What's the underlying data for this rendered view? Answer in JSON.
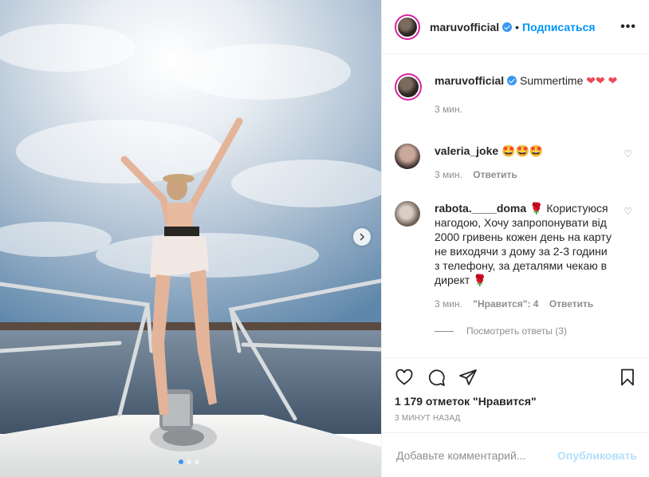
{
  "post": {
    "username": "maruvofficial",
    "separator": "•",
    "follow_label": "Подписаться",
    "more_label": "•••",
    "verified_color": "#3897f0",
    "accent_color": "#0095f6"
  },
  "caption": {
    "username": "maruvofficial",
    "text": "Summertime",
    "emoji": "❤❤ ❤",
    "time": "3 мин."
  },
  "comments": [
    {
      "username": "valeria_joke",
      "text": "🤩🤩🤩",
      "time": "3 мин.",
      "reply_label": "Ответить"
    },
    {
      "username": "rabota.____doma",
      "text": "🌹 Користуюся нагодою, Хочу запропонувати від 2000 гривень кожен день на карту не виходячи з дому за 2-3 години з телефону, за деталями чекаю в директ 🌹",
      "time": "3 мин.",
      "likes": "\"Нравится\": 4",
      "reply_label": "Ответить"
    }
  ],
  "view_replies": "Посмотреть ответы (3)",
  "likes_text": "1 179 отметок \"Нравится\"",
  "time_ago": "3 минут назад",
  "add_comment": {
    "placeholder": "Добавьте комментарий...",
    "publish_label": "Опубликовать"
  },
  "carousel": {
    "slides": 3,
    "active": 1
  }
}
